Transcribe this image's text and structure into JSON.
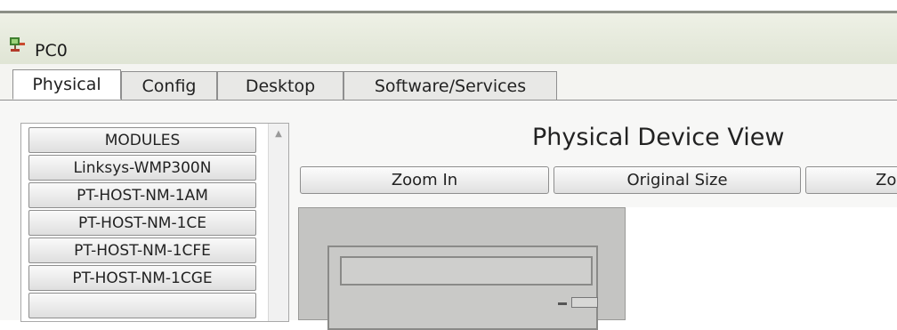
{
  "window": {
    "title": "PC0",
    "icon": "pc-device-icon"
  },
  "tabs": [
    {
      "label": "Physical",
      "active": true
    },
    {
      "label": "Config",
      "active": false
    },
    {
      "label": "Desktop",
      "active": false
    },
    {
      "label": "Software/Services",
      "active": false
    }
  ],
  "modules": {
    "header": "MODULES",
    "items": [
      "Linksys-WMP300N",
      "PT-HOST-NM-1AM",
      "PT-HOST-NM-1CE",
      "PT-HOST-NM-1CFE",
      "PT-HOST-NM-1CGE"
    ]
  },
  "physical_view": {
    "title": "Physical Device View",
    "zoom_in": "Zoom In",
    "original_size": "Original Size",
    "zoom_out": "Zoom Out"
  }
}
